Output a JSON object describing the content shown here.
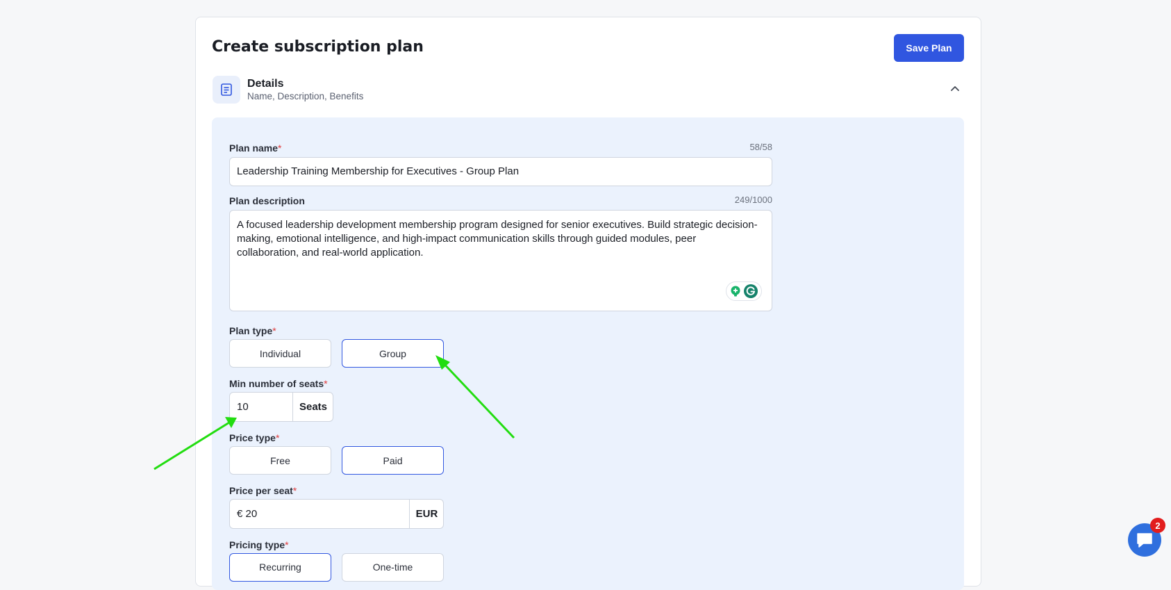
{
  "page": {
    "title": "Create subscription plan",
    "save_label": "Save Plan"
  },
  "section": {
    "title": "Details",
    "subtitle": "Name, Description, Benefits"
  },
  "form": {
    "plan_name": {
      "label": "Plan name",
      "required": "*",
      "counter": "58/58",
      "value": "Leadership Training Membership for Executives - Group Plan"
    },
    "plan_description": {
      "label": "Plan description",
      "counter": "249/1000",
      "value": "A focused leadership development membership program designed for senior executives. Build strategic decision-making, emotional intelligence, and high-impact communication skills through guided modules, peer collaboration, and real-world application."
    },
    "plan_type": {
      "label": "Plan type",
      "required": "*",
      "options": [
        "Individual",
        "Group"
      ],
      "selected": "Group"
    },
    "min_seats": {
      "label": "Min number of seats",
      "required": "*",
      "value": "10",
      "suffix": "Seats"
    },
    "price_type": {
      "label": "Price type",
      "required": "*",
      "options": [
        "Free",
        "Paid"
      ],
      "selected": "Paid"
    },
    "price_per_seat": {
      "label": "Price per seat",
      "required": "*",
      "value": "€ 20",
      "currency": "EUR"
    },
    "pricing_type": {
      "label": "Pricing type",
      "required": "*",
      "options": [
        "Recurring",
        "One-time"
      ],
      "selected": "Recurring"
    }
  },
  "chat": {
    "badge_count": "2"
  },
  "colors": {
    "primary": "#3056e0",
    "panel_bg": "#ebf2fd",
    "required": "#e03b3b",
    "annotation_arrow": "#22dd10",
    "chat": "#2f6fde",
    "badge": "#e21d1d"
  },
  "icons": [
    "document-icon",
    "chevron-up-icon",
    "grammarly-icon",
    "chat-icon"
  ]
}
